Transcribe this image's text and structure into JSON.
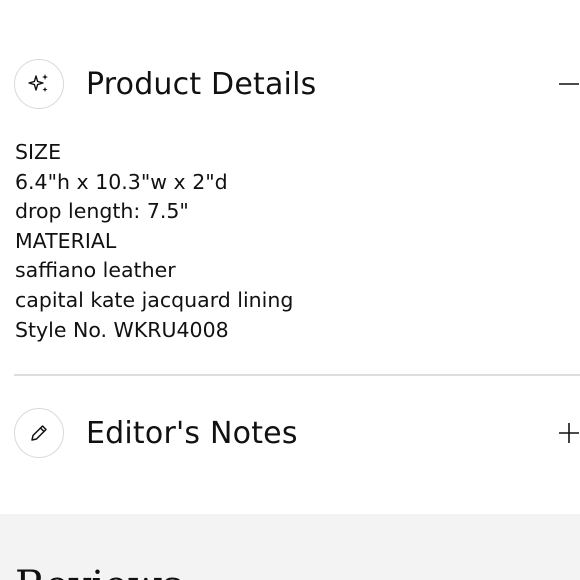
{
  "product_details": {
    "title": "Product Details",
    "icon": "sparkles-icon",
    "toggle_icon": "minus-icon",
    "expanded": true,
    "lines": [
      "SIZE",
      "6.4\"h x 10.3\"w x 2\"d",
      "drop length: 7.5\"",
      "MATERIAL",
      "saffiano leather",
      "capital kate jacquard lining",
      "Style No. WKRU4008"
    ]
  },
  "editors_notes": {
    "title": "Editor's Notes",
    "icon": "pencil-icon",
    "toggle_icon": "plus-icon",
    "expanded": false
  },
  "reviews": {
    "title": "Reviews"
  },
  "colors": {
    "text": "#111111",
    "border": "#d9d9d9",
    "divider": "#dddddd",
    "reviews_background": "#f3f3f3"
  }
}
